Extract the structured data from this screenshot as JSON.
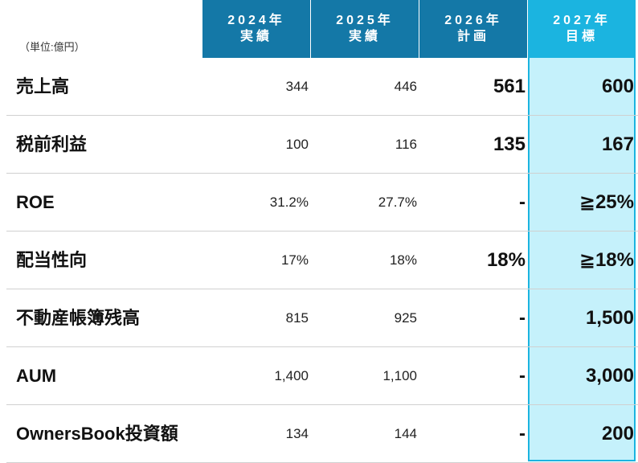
{
  "unit_label": "（単位:億円）",
  "headers": [
    {
      "year": "2024年",
      "kind": "実績"
    },
    {
      "year": "2025年",
      "kind": "実績"
    },
    {
      "year": "2026年",
      "kind": "計画"
    },
    {
      "year": "2027年",
      "kind": "目標"
    }
  ],
  "rows": [
    {
      "label": "売上高",
      "y2024": "344",
      "y2025": "446",
      "y2026": "561",
      "y2027": "600"
    },
    {
      "label": "税前利益",
      "y2024": "100",
      "y2025": "116",
      "y2026": "135",
      "y2027": "167"
    },
    {
      "label": "ROE",
      "y2024": "31.2%",
      "y2025": "27.7%",
      "y2026": "-",
      "y2027": "≧25%"
    },
    {
      "label": "配当性向",
      "y2024": "17%",
      "y2025": "18%",
      "y2026": "18%",
      "y2027": "≧18%"
    },
    {
      "label": "不動産帳簿残高",
      "y2024": "815",
      "y2025": "925",
      "y2026": "-",
      "y2027": "1,500"
    },
    {
      "label": "AUM",
      "y2024": "1,400",
      "y2025": "1,100",
      "y2026": "-",
      "y2027": "3,000"
    },
    {
      "label": "OwnersBook投資額",
      "y2024": "134",
      "y2025": "144",
      "y2026": "-",
      "y2027": "200"
    }
  ],
  "colors": {
    "header": "#1478a7",
    "target_header": "#1bb4e0",
    "target_fill": "#c5f1fb"
  }
}
